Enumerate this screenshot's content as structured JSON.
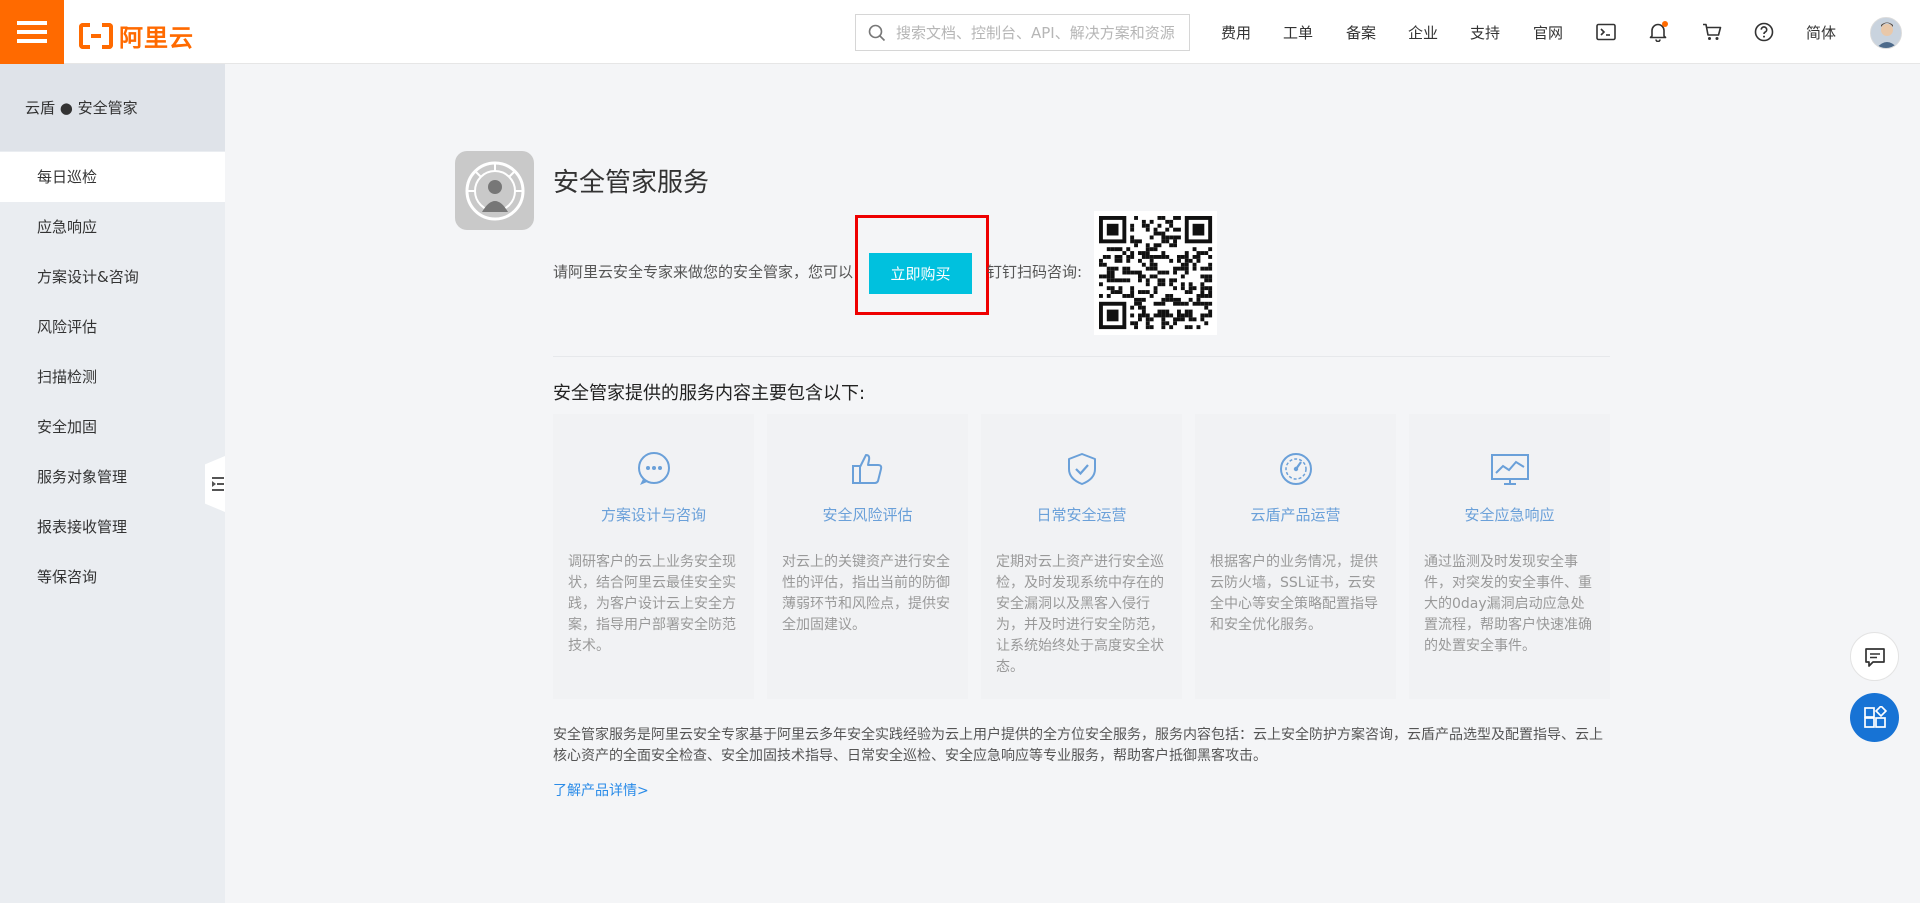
{
  "header": {
    "logo_text": "阿里云",
    "search_placeholder": "搜索文档、控制台、API、解决方案和资源",
    "nav": [
      "费用",
      "工单",
      "备案",
      "企业",
      "支持",
      "官网"
    ],
    "language": "简体"
  },
  "sidebar": {
    "title": "云盾 ● 安全管家",
    "items": [
      {
        "label": "每日巡检",
        "active": true
      },
      {
        "label": "应急响应"
      },
      {
        "label": "方案设计&咨询"
      },
      {
        "label": "风险评估"
      },
      {
        "label": "扫描检测"
      },
      {
        "label": "安全加固"
      },
      {
        "label": "服务对象管理"
      },
      {
        "label": "报表接收管理"
      },
      {
        "label": "等保咨询"
      }
    ]
  },
  "main": {
    "title": "安全管家服务",
    "intro_prefix": "请阿里云安全专家来做您的安全管家，您可以",
    "buy_label": "立即购买",
    "intro_suffix": "钉钉扫码咨询:",
    "section_title": "安全管家提供的服务内容主要包含以下:",
    "cards": [
      {
        "icon": "chat-bubble-icon",
        "title": "方案设计与咨询",
        "desc": "调研客户的云上业务安全现状，结合阿里云最佳安全实践，为客户设计云上安全方案，指导用户部署安全防范技术。"
      },
      {
        "icon": "thumbs-up-icon",
        "title": "安全风险评估",
        "desc": "对云上的关键资产进行安全性的评估，指出当前的防御薄弱环节和风险点，提供安全加固建议。"
      },
      {
        "icon": "shield-check-icon",
        "title": "日常安全运营",
        "desc": "定期对云上资产进行安全巡检，及时发现系统中存在的安全漏洞以及黑客入侵行为，并及时进行安全防范，让系统始终处于高度安全状态。"
      },
      {
        "icon": "gauge-icon",
        "title": "云盾产品运营",
        "desc": "根据客户的业务情况，提供云防火墙，SSL证书，云安全中心等安全策略配置指导和安全优化服务。"
      },
      {
        "icon": "monitor-chart-icon",
        "title": "安全应急响应",
        "desc": "通过监测及时发现安全事件，对突发的安全事件、重大的0day漏洞启动应急处置流程，帮助客户快速准确的处置安全事件。"
      }
    ],
    "description": "安全管家服务是阿里云安全专家基于阿里云多年安全实践经验为云上用户提供的全方位安全服务，服务内容包括：云上安全防护方案咨询，云盾产品选型及配置指导、云上核心资产的全面安全检查、安全加固技术指导、日常安全巡检、安全应急响应等专业服务，帮助客户抵御黑客攻击。",
    "more_link": "了解产品详情>"
  },
  "colors": {
    "brand": "#ff6a00",
    "buy_button": "#00c1de",
    "highlight_box": "#ee0000",
    "card_title": "#6aa0d9",
    "link": "#2a8be8"
  }
}
